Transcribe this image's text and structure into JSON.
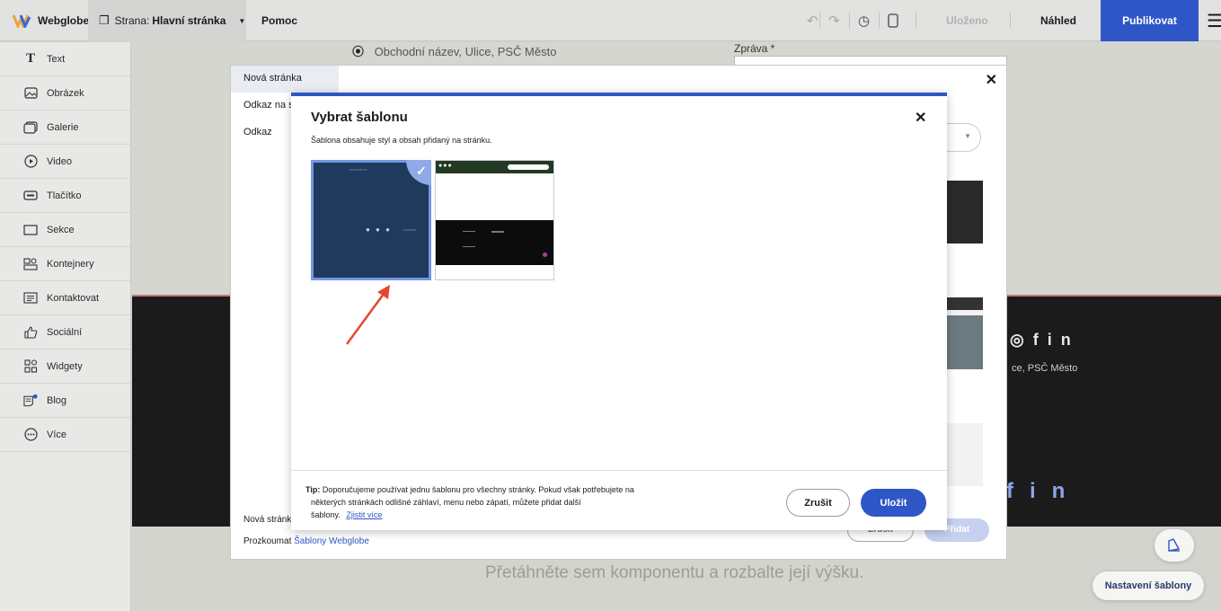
{
  "topbar": {
    "logo": "Webglobe",
    "page_prefix": "Strana:",
    "page_name": "Hlavní stránka",
    "help": "Pomoc",
    "saved": "Uloženo",
    "preview": "Náhled",
    "publish": "Publikovat"
  },
  "sidebar": {
    "items": [
      {
        "label": "Text",
        "icon": "text-icon"
      },
      {
        "label": "Obrázek",
        "icon": "image-icon"
      },
      {
        "label": "Galerie",
        "icon": "gallery-icon"
      },
      {
        "label": "Video",
        "icon": "video-icon"
      },
      {
        "label": "Tlačítko",
        "icon": "button-icon"
      },
      {
        "label": "Sekce",
        "icon": "section-icon"
      },
      {
        "label": "Kontejnery",
        "icon": "container-icon"
      },
      {
        "label": "Kontaktovat",
        "icon": "contact-icon"
      },
      {
        "label": "Sociální",
        "icon": "like-icon"
      },
      {
        "label": "Widgety",
        "icon": "widgets-icon"
      },
      {
        "label": "Blog",
        "icon": "blog-icon"
      },
      {
        "label": "Více",
        "icon": "more-icon"
      }
    ]
  },
  "canvas": {
    "address": "Obchodní název, Ulice, PSČ Město",
    "message_label": "Zpráva *",
    "footer_address": "ce, PSČ Město",
    "drop_hint": "Přetáhněte sem komponentu a rozbalte její výšku.",
    "template_settings": "Nastavení šablony"
  },
  "back_dialog": {
    "nav": [
      "Nová stránka",
      "Odkaz na s",
      "Odkaz"
    ],
    "footer_text": "Nová stránka",
    "explore_prefix": "Prozkoumat",
    "explore_link": "Šablony Webglobe",
    "cancel": "Zrušit",
    "add": "Přidat"
  },
  "template_dialog": {
    "title": "Vybrat šablonu",
    "description": "Šablona obsahuje styl a obsah přidaný na stránku.",
    "selected_template_index": 0,
    "tip_label": "Tip:",
    "tip_line1": "Doporučujeme používat jednu šablonu pro všechny stránky. Pokud však potřebujete na",
    "tip_line2": "některých stránkách odlišné záhlaví, menu nebo zápatí, můžete přidat další",
    "tip_line3": "šablony.",
    "tip_link": "Zjistit více",
    "cancel": "Zrušit",
    "save": "Uložit"
  },
  "colors": {
    "accent": "#2f56c6",
    "selected_border": "#7497e2",
    "annotation_arrow": "#e8452f"
  }
}
